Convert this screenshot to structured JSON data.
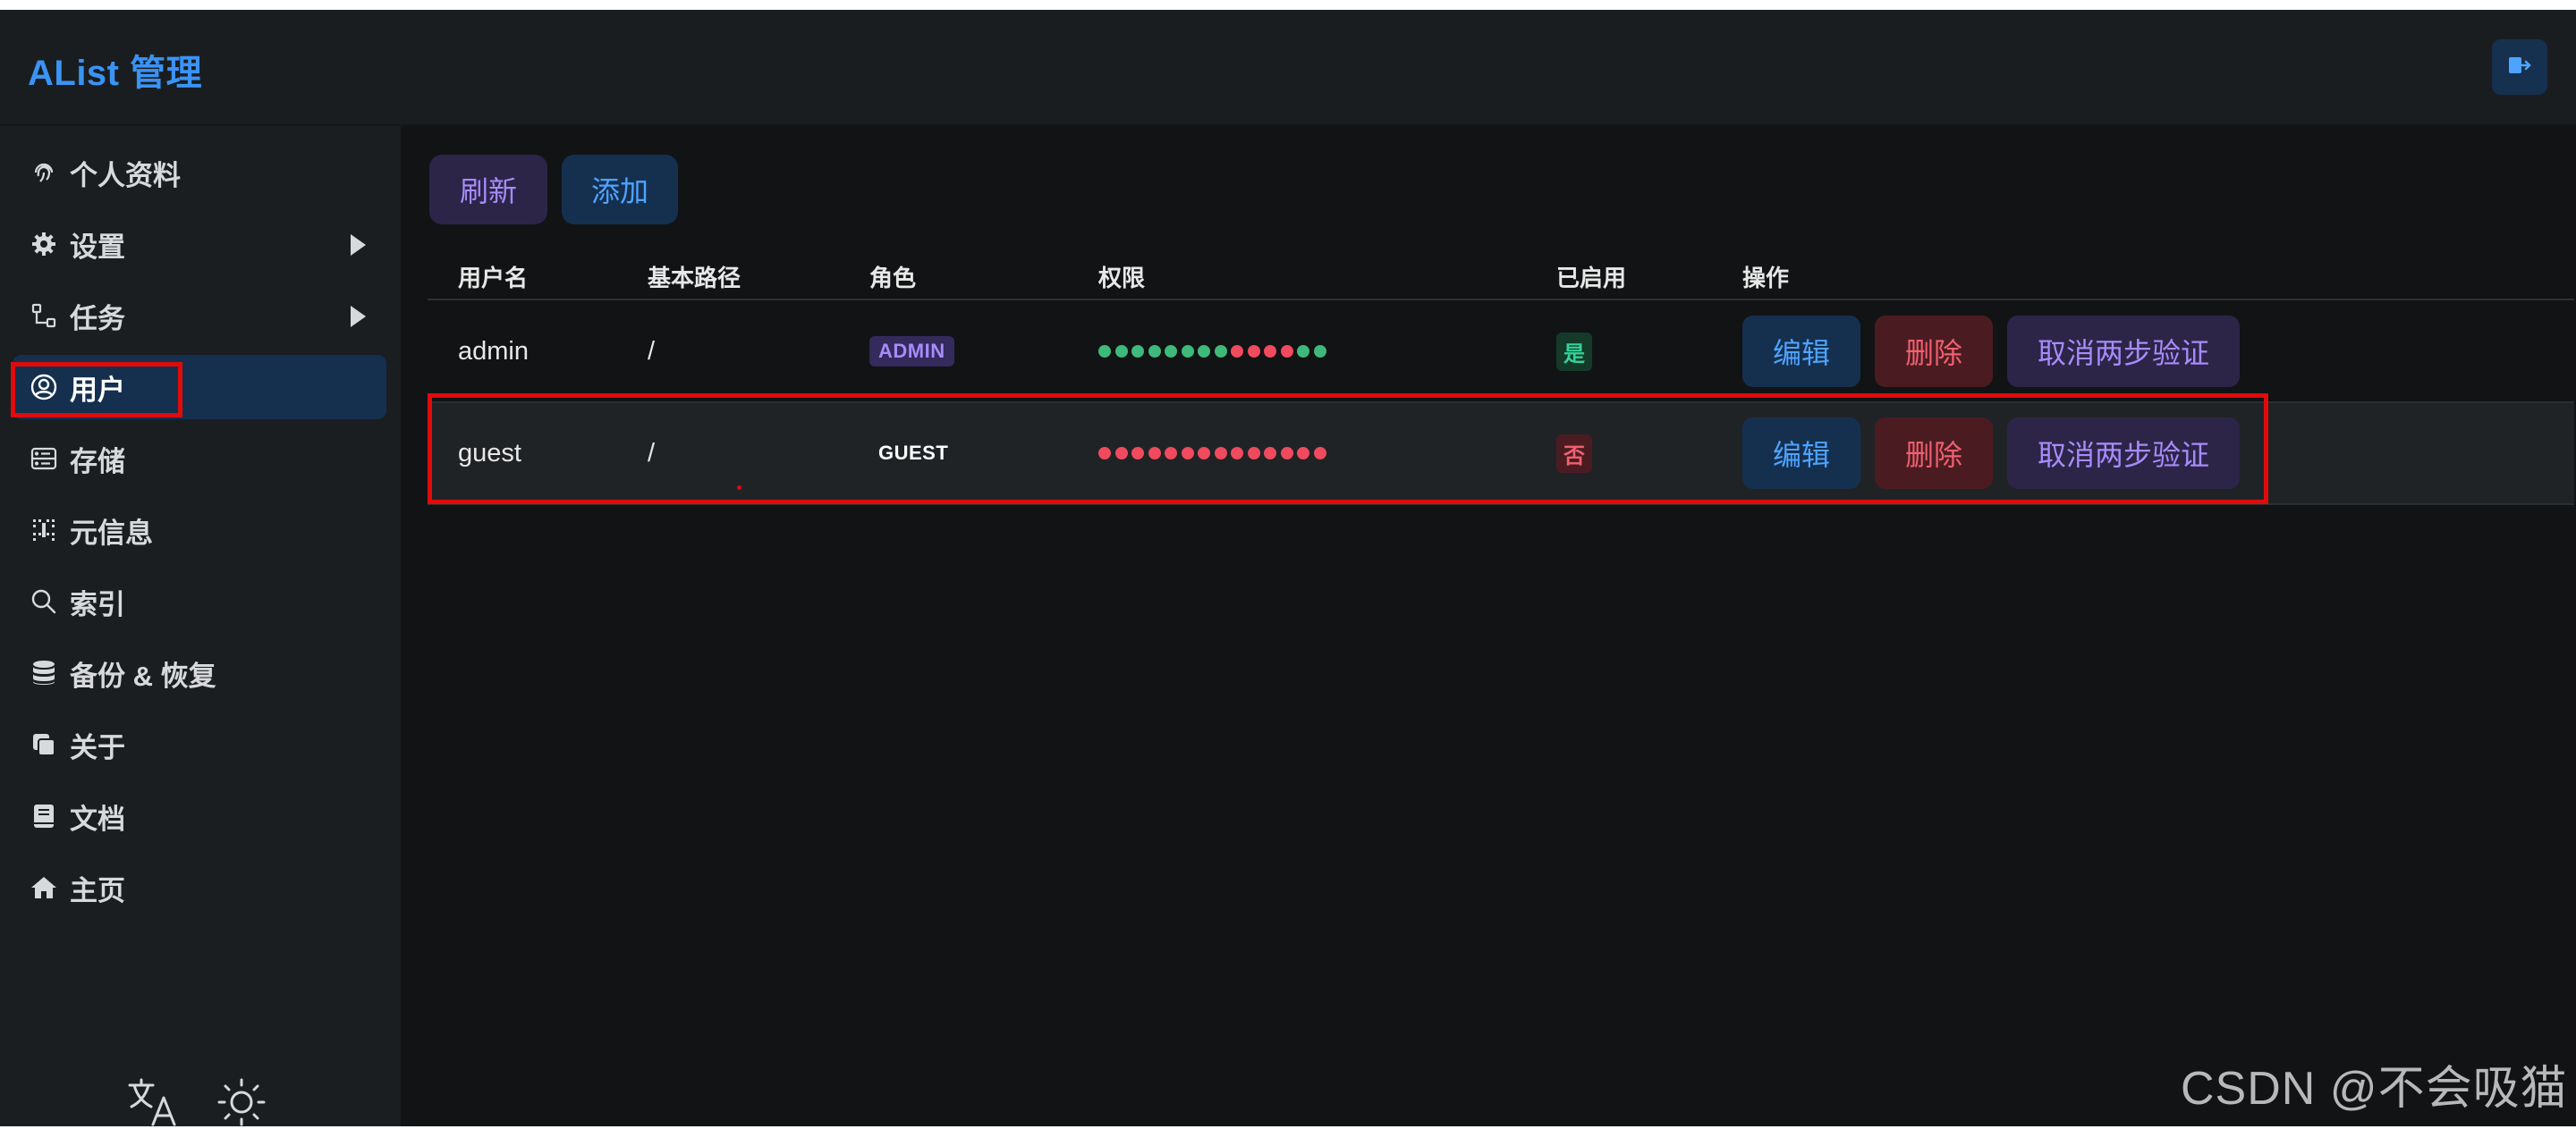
{
  "header": {
    "brand": "AList 管理"
  },
  "sidebar": {
    "items": [
      {
        "label": "个人资料",
        "icon": "fingerprint-icon"
      },
      {
        "label": "设置",
        "icon": "gear-icon",
        "expandable": true
      },
      {
        "label": "任务",
        "icon": "tree-icon",
        "expandable": true
      },
      {
        "label": "用户",
        "icon": "user-circle-icon",
        "active": true
      },
      {
        "label": "存储",
        "icon": "storage-icon"
      },
      {
        "label": "元信息",
        "icon": "meta-icon"
      },
      {
        "label": "索引",
        "icon": "search-icon"
      },
      {
        "label": "备份 & 恢复",
        "icon": "database-icon"
      },
      {
        "label": "关于",
        "icon": "copy-icon"
      },
      {
        "label": "文档",
        "icon": "book-icon"
      },
      {
        "label": "主页",
        "icon": "home-icon"
      }
    ],
    "bottom_icons": [
      "translate-icon",
      "sun-icon"
    ]
  },
  "toolbar": {
    "refresh_label": "刷新",
    "add_label": "添加"
  },
  "table": {
    "headers": [
      "用户名",
      "基本路径",
      "角色",
      "权限",
      "已启用",
      "操作"
    ],
    "rows": [
      {
        "username": "admin",
        "base_path": "/",
        "role": "ADMIN",
        "permissions_dots": [
          "green",
          "green",
          "green",
          "green",
          "green",
          "green",
          "green",
          "green",
          "red",
          "red",
          "red",
          "red",
          "green",
          "green"
        ],
        "enabled": "是",
        "actions": {
          "edit": "编辑",
          "delete": "删除",
          "cancel_2fa": "取消两步验证"
        }
      },
      {
        "username": "guest",
        "base_path": "/",
        "role": "GUEST",
        "permissions_dots": [
          "red",
          "red",
          "red",
          "red",
          "red",
          "red",
          "red",
          "red",
          "red",
          "red",
          "red",
          "red",
          "red",
          "red"
        ],
        "enabled": "否",
        "actions": {
          "edit": "编辑",
          "delete": "删除",
          "cancel_2fa": "取消两步验证"
        }
      }
    ]
  },
  "colors": {
    "accent_blue": "#3a93f5",
    "perm_green": "#3fb97a",
    "perm_red": "#f04a5e",
    "highlight_red": "#e00b0b"
  },
  "watermark": "CSDN @不会吸猫"
}
